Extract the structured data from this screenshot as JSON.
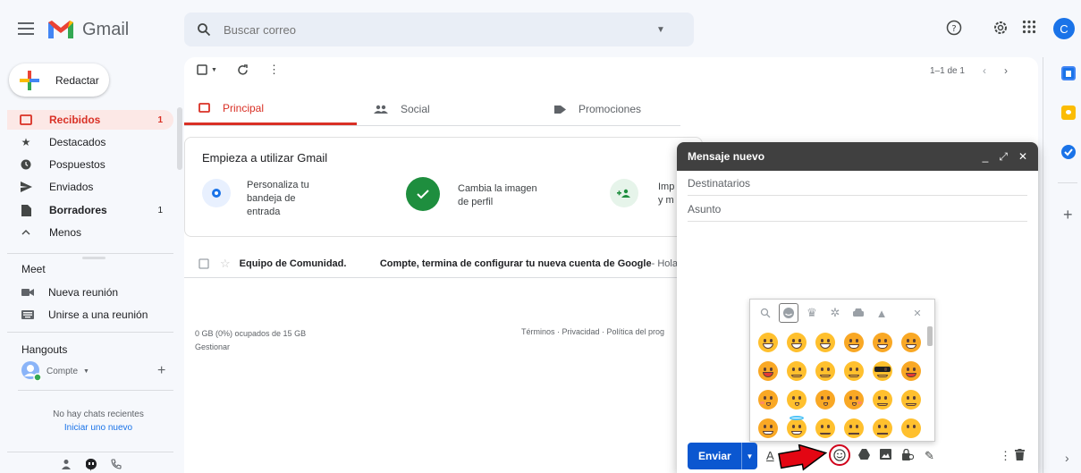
{
  "header": {
    "app_name": "Gmail",
    "search_placeholder": "Buscar correo",
    "avatar_letter": "C"
  },
  "sidebar": {
    "compose_label": "Redactar",
    "items": [
      {
        "label": "Recibidos",
        "count": "1",
        "icon": "inbox-icon"
      },
      {
        "label": "Destacados",
        "count": "",
        "icon": "star-icon"
      },
      {
        "label": "Pospuestos",
        "count": "",
        "icon": "clock-icon"
      },
      {
        "label": "Enviados",
        "count": "",
        "icon": "send-icon"
      },
      {
        "label": "Borradores",
        "count": "1",
        "icon": "draft-icon"
      },
      {
        "label": "Menos",
        "count": "",
        "icon": "chevron-up-icon"
      }
    ],
    "meet": {
      "header": "Meet",
      "new_meeting": "Nueva reunión",
      "join_meeting": "Unirse a una reunión"
    },
    "hangouts": {
      "header": "Hangouts",
      "user": "Compte",
      "no_chats": "No hay chats recientes",
      "start_new": "Iniciar uno nuevo"
    }
  },
  "toolbar": {
    "pagination": "1–1 de 1"
  },
  "tabs": [
    {
      "label": "Principal"
    },
    {
      "label": "Social"
    },
    {
      "label": "Promociones"
    }
  ],
  "setup_card": {
    "title": "Empieza a utilizar Gmail",
    "steps": [
      {
        "line1": "Personaliza tu",
        "line2": "bandeja de",
        "line3": "entrada"
      },
      {
        "line1": "Cambia la imagen",
        "line2": "de perfil"
      },
      {
        "line1": "Imp",
        "line2": "y m"
      }
    ]
  },
  "email_rows": [
    {
      "sender": "Equipo de Comunidad.",
      "subject": "Compte, termina de configurar tu nueva cuenta de Google",
      "snippet": " - Hola,"
    }
  ],
  "footer": {
    "storage": "0 GB (0%) ocupados de 15 GB",
    "manage": "Gestionar",
    "links": "Términos · Privacidad · Política del prog"
  },
  "compose": {
    "title": "Mensaje nuevo",
    "to_placeholder": "Destinatarios",
    "subject_placeholder": "Asunto",
    "send_label": "Enviar"
  },
  "colors": {
    "accent_red": "#d93025",
    "send_blue": "#0b57d0",
    "compose_header": "#404040"
  }
}
